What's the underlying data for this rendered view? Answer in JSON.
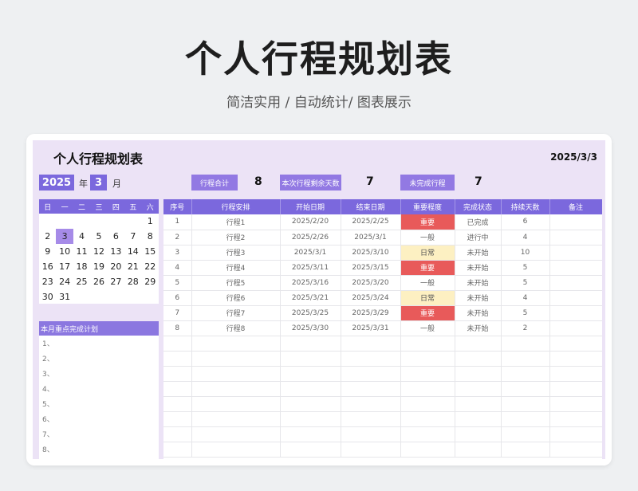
{
  "hero": {
    "title": "个人行程规划表",
    "subtitle": "简洁实用 / 自动统计/ 图表展示"
  },
  "sheet": {
    "title": "个人行程规划表",
    "date": "2025/3/3",
    "year": "2025",
    "year_label": "年",
    "month": "3",
    "month_label": "月",
    "stats": [
      {
        "label": "行程合计",
        "value": "8"
      },
      {
        "label": "本次行程剩余天数",
        "value": "7"
      },
      {
        "label": "未完成行程",
        "value": "7"
      }
    ]
  },
  "calendar": {
    "weekdays": [
      "日",
      "一",
      "二",
      "三",
      "四",
      "五",
      "六"
    ],
    "weeks": [
      [
        "",
        "",
        "",
        "",
        "",
        "",
        "1"
      ],
      [
        "2",
        "3",
        "4",
        "5",
        "6",
        "7",
        "8"
      ],
      [
        "9",
        "10",
        "11",
        "12",
        "13",
        "14",
        "15"
      ],
      [
        "16",
        "17",
        "18",
        "19",
        "20",
        "21",
        "22"
      ],
      [
        "23",
        "24",
        "25",
        "26",
        "27",
        "28",
        "29"
      ],
      [
        "30",
        "31",
        "",
        "",
        "",
        "",
        ""
      ]
    ],
    "today": "3"
  },
  "plan": {
    "title": "本月重点完成计划",
    "items": [
      "1、",
      "2、",
      "3、",
      "4、",
      "5、",
      "6、",
      "7、",
      "8、"
    ]
  },
  "table": {
    "headers": [
      "序号",
      "行程安排",
      "开始日期",
      "结束日期",
      "重要程度",
      "完成状态",
      "持续天数",
      "备注"
    ],
    "rows": [
      [
        "1",
        "行程1",
        "2025/2/20",
        "2025/2/25",
        "重要",
        "已完成",
        "6",
        ""
      ],
      [
        "2",
        "行程2",
        "2025/2/26",
        "2025/3/1",
        "一般",
        "进行中",
        "4",
        ""
      ],
      [
        "3",
        "行程3",
        "2025/3/1",
        "2025/3/10",
        "日常",
        "未开始",
        "10",
        ""
      ],
      [
        "4",
        "行程4",
        "2025/3/11",
        "2025/3/15",
        "重要",
        "未开始",
        "5",
        ""
      ],
      [
        "5",
        "行程5",
        "2025/3/16",
        "2025/3/20",
        "一般",
        "未开始",
        "5",
        ""
      ],
      [
        "6",
        "行程6",
        "2025/3/21",
        "2025/3/24",
        "日常",
        "未开始",
        "4",
        ""
      ],
      [
        "7",
        "行程7",
        "2025/3/25",
        "2025/3/29",
        "重要",
        "未开始",
        "5",
        ""
      ],
      [
        "8",
        "行程8",
        "2025/3/30",
        "2025/3/31",
        "一般",
        "未开始",
        "2",
        ""
      ]
    ],
    "empty_rows": 8
  }
}
